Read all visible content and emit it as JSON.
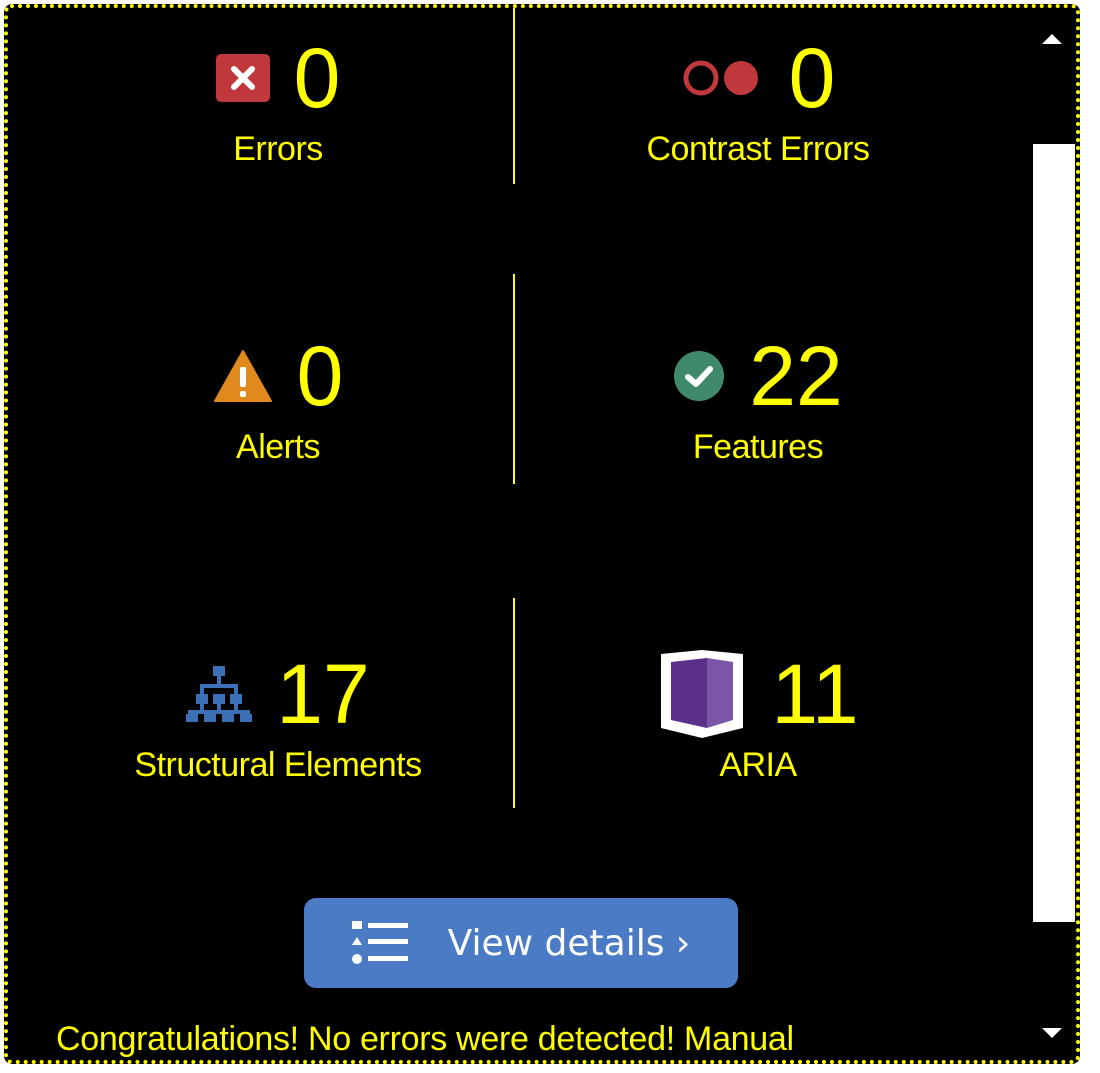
{
  "summary": {
    "errors": {
      "count": "0",
      "label": "Errors",
      "icon": "error-x-icon",
      "color": "#c0383c"
    },
    "contrast_errors": {
      "count": "0",
      "label": "Contrast Errors",
      "icon": "contrast-icon",
      "color": "#c0383c"
    },
    "alerts": {
      "count": "0",
      "label": "Alerts",
      "icon": "alert-triangle-icon",
      "color": "#e08a1e"
    },
    "features": {
      "count": "22",
      "label": "Features",
      "icon": "checkmark-circle-icon",
      "color": "#3f8a6a"
    },
    "structure": {
      "count": "17",
      "label": "Structural Elements",
      "icon": "hierarchy-icon",
      "color": "#3b6fb6"
    },
    "aria": {
      "count": "11",
      "label": "ARIA",
      "icon": "aria-shield-icon",
      "color": "#5a3088"
    }
  },
  "view_details": {
    "label": "View details ›",
    "icon": "list-icon",
    "color": "#4b7bc4"
  },
  "message": "Congratulations! No errors were detected! Manual",
  "theme": {
    "background": "#000000",
    "text": "#ffff00",
    "border": "#ffff00"
  }
}
